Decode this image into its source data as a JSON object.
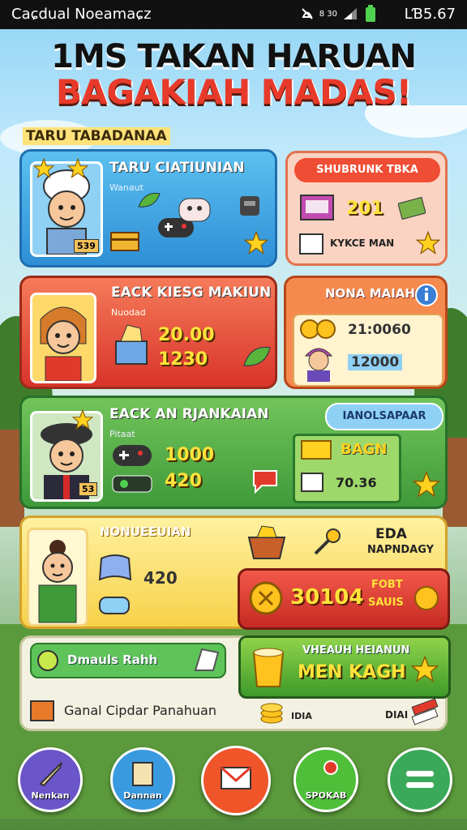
{
  "status_bar": {
    "left": "Caɕdual Noeamaɕz",
    "right": "LƁ5.67",
    "signal_label": "8 30"
  },
  "title": {
    "line1": "1MS TAKAN HARUAN",
    "line2": "BAGAKIAH MADAS!"
  },
  "section_label": "TARU TABADANAA",
  "cards": {
    "blue_card": {
      "title": "TARU CIATIUNIAN",
      "subtitle": "Wanaut",
      "avatar_badge": "539",
      "accent": "#3aa8e6"
    },
    "pink_card": {
      "title": "SHUBRUNK TBKA",
      "value": "201",
      "footer": "KYKCE MAN"
    },
    "red_card": {
      "title": "EACK KIESG MAKIUN",
      "subtitle": "Nuodad",
      "value1": "20.00",
      "value2": "1230",
      "accent": "#e8473a"
    },
    "mona_card": {
      "title": "NONA MAIAH",
      "value1": "21:0060",
      "value2": "12000"
    },
    "green_card": {
      "title": "EACK AN RJANKAIAN",
      "subtitle": "Pitaat",
      "badge": "53",
      "value1": "1000",
      "value2": "420",
      "pill": "IANOLSAPAAR",
      "accent": "#4fa84a"
    },
    "green_box": {
      "label": "BAGN",
      "value": "70.36"
    },
    "yellow_card": {
      "title": "NONUEEUIAN",
      "value": "420"
    },
    "reward": {
      "title": "EDA",
      "subtitle": "NAPNDAGY",
      "value": "30104",
      "side1": "FOBT",
      "side2": "SAUIS"
    },
    "bottom_left": {
      "pill": "Dmauls Rahh",
      "row": "Ganal Cipdar Panahuan",
      "right1": "IDIA",
      "right2": "DIAI"
    },
    "green_cta": {
      "line1": "VHEAUH HEIANUN",
      "line2": "MEN KAGH"
    }
  },
  "nav": [
    {
      "label": "Nenkan",
      "icon": "sword-icon",
      "color": "#6a55c9"
    },
    {
      "label": "Dannan",
      "icon": "scroll-icon",
      "color": "#3a9ae0"
    },
    {
      "label": "",
      "icon": "envelope-icon",
      "color": "#f0552a"
    },
    {
      "label": "SPOKAB",
      "icon": "alert-icon",
      "color": "#4fbf3a"
    },
    {
      "label": "",
      "icon": "menu-icon",
      "color": "#3aaa5a"
    }
  ]
}
